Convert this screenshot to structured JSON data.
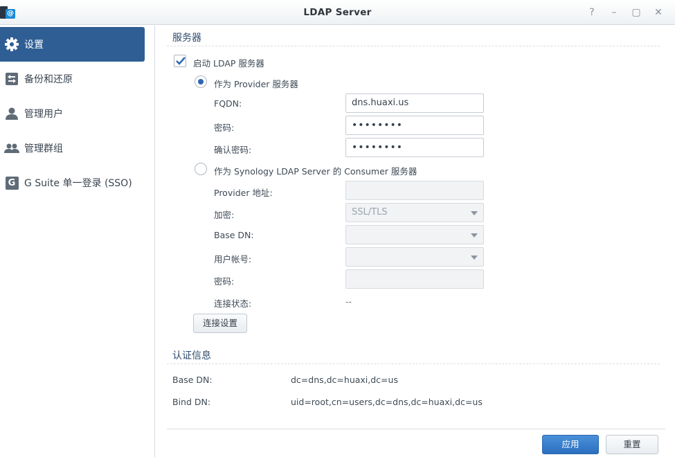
{
  "window": {
    "title": "LDAP Server",
    "help_glyph": "?",
    "minimize_glyph": "–",
    "maximize_glyph": "▢",
    "close_glyph": "✕",
    "app_icon_glyph": "@"
  },
  "sidebar": {
    "items": [
      {
        "label": "设置",
        "icon": "gear-icon",
        "active": true
      },
      {
        "label": "备份和还原",
        "icon": "backup-restore-icon",
        "active": false
      },
      {
        "label": "管理用户",
        "icon": "user-icon",
        "active": false
      },
      {
        "label": "管理群组",
        "icon": "group-icon",
        "active": false
      },
      {
        "label": "G Suite 单一登录 (SSO)",
        "icon": "g-suite-icon",
        "active": false
      }
    ],
    "gsuite_glyph": "G"
  },
  "server": {
    "section_title": "服务器",
    "enable_label": "启动 LDAP 服务器",
    "enable_checked": true,
    "provider_option": "作为 Provider 服务器",
    "fqdn_label": "FQDN:",
    "fqdn_value": "dns.huaxi.us",
    "password_label": "密码:",
    "password_value": "••••••••",
    "confirm_label": "确认密码:",
    "confirm_value": "••••••••",
    "consumer_option": "作为 Synology LDAP Server 的 Consumer 服务器",
    "provider_addr_label": "Provider 地址:",
    "provider_addr_value": "",
    "encryption_label": "加密:",
    "encryption_value": "SSL/TLS",
    "base_dn_label": "Base DN:",
    "base_dn_value": "",
    "user_account_label": "用户帐号:",
    "user_account_value": "",
    "consumer_password_label": "密码:",
    "consumer_password_value": "",
    "status_label": "连接状态:",
    "status_value": "--",
    "connection_settings_button": "连接设置"
  },
  "auth": {
    "section_title": "认证信息",
    "base_dn_label": "Base DN:",
    "base_dn_value": "dc=dns,dc=huaxi,dc=us",
    "bind_dn_label": "Bind DN:",
    "bind_dn_value": "uid=root,cn=users,dc=dns,dc=huaxi,dc=us"
  },
  "footer": {
    "apply_button": "应用",
    "reset_button": "重置"
  },
  "colors": {
    "accent": "#2f5e94",
    "primary_button": "#2b6fbf",
    "section_title": "#2d4a6e"
  }
}
